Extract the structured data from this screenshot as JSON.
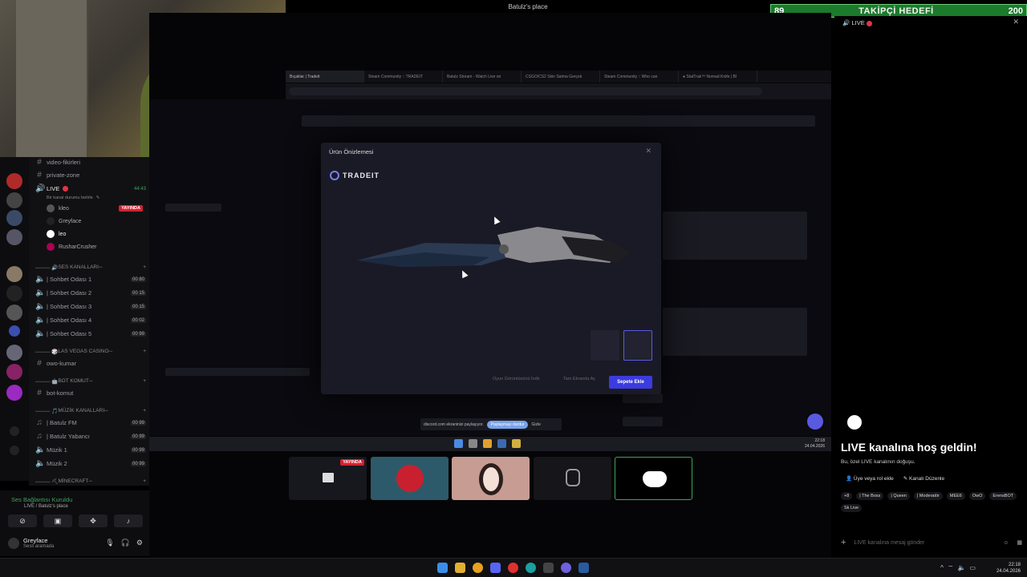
{
  "window_title": "Batulz's place",
  "follower_goal": {
    "current": "89",
    "label": "TAKİPÇİ HEDEFİ",
    "target": "200"
  },
  "browser": {
    "tabs": [
      "Bıçaklar | Tradeit",
      "Steam Community :: TRADEIT",
      "Batulz Stream - Watch Live on",
      "CSGO/CS2 Skin Satma Gerçek",
      "Steam Community :: Who can",
      "● StatTrak™ Nomad Knife | Bl"
    ]
  },
  "modal": {
    "title": "Ürün Önizlemesi",
    "brand": "TRADEIT",
    "btn_inspect": "Oyun Görüntüsünü İndir",
    "btn_fullscreen": "Tam Ekranda Aç",
    "btn_add_cart": "Sepete Ekle"
  },
  "share_bar": {
    "text": "discord.com ekraninizi paylaşıyor.",
    "stop": "Paylaşmayı durdur",
    "hide": "Gizle"
  },
  "inner_clock": {
    "time": "22:18",
    "date": "24.04.2026"
  },
  "channels": {
    "top_items": [
      "video-fikirleri",
      "private-zone"
    ],
    "live_channel": {
      "name": "LIVE",
      "status": "Bir kanal durumu belirle",
      "time": "44:43"
    },
    "live_users": [
      {
        "name": "kleo",
        "badge": "YAYINDA"
      },
      {
        "name": "Greyface",
        "badge": ""
      },
      {
        "name": "leo",
        "badge": ""
      },
      {
        "name": "RusharCrusher",
        "badge": ""
      }
    ],
    "voice_category": "SES KANALLARI",
    "voice_rooms": [
      {
        "name": "| Sohbet Odası 1",
        "count": "00 80"
      },
      {
        "name": "| Sohbet Odası 2",
        "count": "00 15"
      },
      {
        "name": "| Sohbet Odası 3",
        "count": "00 15"
      },
      {
        "name": "| Sohbet Odası 4",
        "count": "00 02"
      },
      {
        "name": "| Sohbet Odası 5",
        "count": "00 99"
      }
    ],
    "casino_category": "LAS VEGAS CASINO",
    "casino_channel": "owo-kumar",
    "bot_category": "BOT KOMUT",
    "bot_channel": "bot-komut",
    "music_category": "MÜZİK KANALLARI",
    "music_rooms": [
      {
        "name": "| Batulz FM",
        "count": "00 99"
      },
      {
        "name": "| Batulz Yabancı",
        "count": "00 99"
      },
      {
        "name": "Müzik 1",
        "count": "00 99"
      },
      {
        "name": "Müzik 2",
        "count": "00 99"
      }
    ],
    "mc_category": "MİNECRAFT"
  },
  "voice_panel": {
    "status": "Ses Bağlantısı Kuruldu",
    "channel": "LIVE / Batulz's place",
    "user_name": "Greyface",
    "user_status": "Sesli aramada"
  },
  "tile_screen_badge": "YAYINDA",
  "right_panel": {
    "header": "LIVE",
    "welcome": "LIVE kanalına hoş geldin!",
    "desc": "Bu, özel LIVE kanalının doğuşu.",
    "action_role": "Üye veya rol ekle",
    "action_edit": "Kanalı Düzenle",
    "roles": [
      "+8",
      "| The Boss",
      "| Queen",
      "| Moderatör",
      "MEE6",
      "OwO",
      "ErensBOT",
      "Sk Live"
    ],
    "message_placeholder": "LIVE kanalına mesaj gönder"
  },
  "outer_clock": {
    "time": "22:18",
    "date": "24.04.2026"
  },
  "colors": {
    "discord_green": "#3ba55d",
    "live_red": "#e23645",
    "accent_blue": "#3b3be0"
  }
}
